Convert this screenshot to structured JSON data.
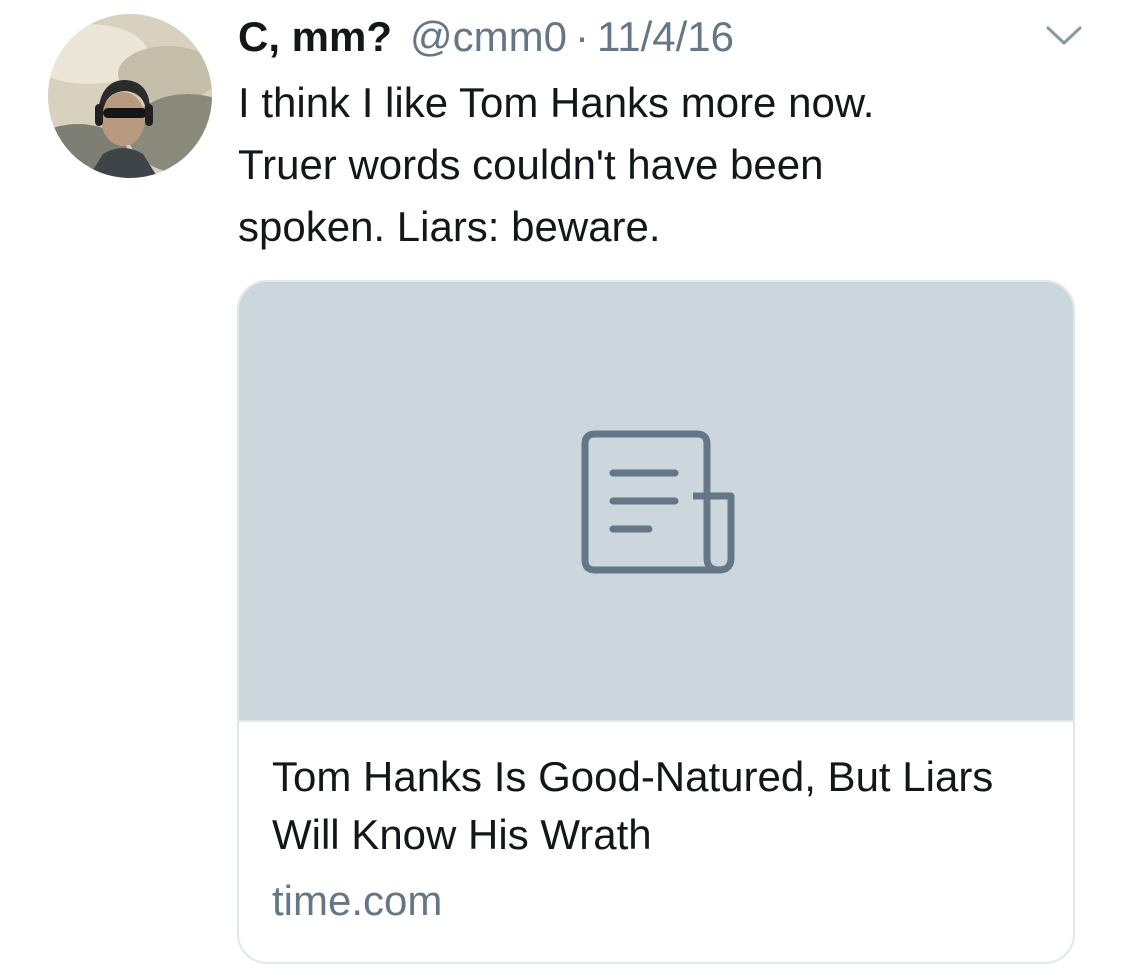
{
  "tweet": {
    "display_name": "C, mm?",
    "handle": "@cmm0",
    "separator": "·",
    "timestamp": "11/4/16",
    "text": "I think I like Tom Hanks more now.\nTruer words couldn't have been\nspoken. Liars: beware.",
    "menu_icon": "chevron-down-icon",
    "avatar_icon": "avatar"
  },
  "card": {
    "placeholder_icon": "document-icon",
    "title": "Tom Hanks Is Good-Natured, But Liars Will Know His Wrath",
    "domain": "time.com"
  },
  "colors": {
    "text_primary": "#14171a",
    "text_secondary": "#657786",
    "card_media_bg": "#ccd6dd",
    "card_border": "#e1e8ed",
    "icon_gray": "#657786"
  }
}
